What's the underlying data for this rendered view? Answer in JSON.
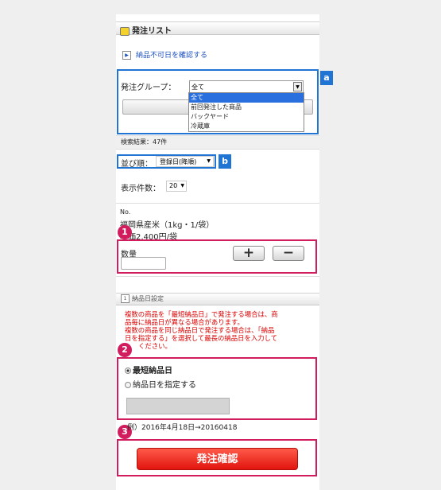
{
  "header": {
    "title": "発注リスト"
  },
  "links": {
    "delivery_unavailable": "納品不可日を確認する"
  },
  "order_group": {
    "label": "発注グループ：",
    "selected": "全て",
    "options": [
      "全て",
      "前回発注した商品",
      "バックヤード",
      "冷蔵庫"
    ]
  },
  "search": {
    "results": "検索結果：47件"
  },
  "sort": {
    "label": "並び順：",
    "value": "登録日(降順)"
  },
  "per_page": {
    "label": "表示件数：",
    "value": "20"
  },
  "product": {
    "no_label": "No.",
    "name": "福岡県産米（1kg・1/袋）",
    "price": "単価2,400円/袋",
    "qty_label": "数量",
    "plus": "+",
    "minus": "−"
  },
  "delivery": {
    "section_title": "納品日設定",
    "notes": [
      "複数の商品を「最短納品日」で発注する場合は、商",
      "品毎に納品日が異なる場合があります。",
      "複数の商品を同じ納品日で発注する場合は、「納品",
      "日を指定する」を選択して最長の納品日を入力して",
      "ください。"
    ],
    "option_shortest": "最短納品日",
    "option_specify": "納品日を指定する",
    "example": "例）2016年4月18日→20160418"
  },
  "confirm_button": "発注確認",
  "annotations": {
    "a": "a",
    "b": "b",
    "n1": "1",
    "n2": "2",
    "n3": "3"
  },
  "colors": {
    "annotation_blue": "#1f74d4",
    "annotation_pink": "#d11d5e",
    "confirm_red": "#e0150e",
    "note_red": "#dd0000"
  }
}
